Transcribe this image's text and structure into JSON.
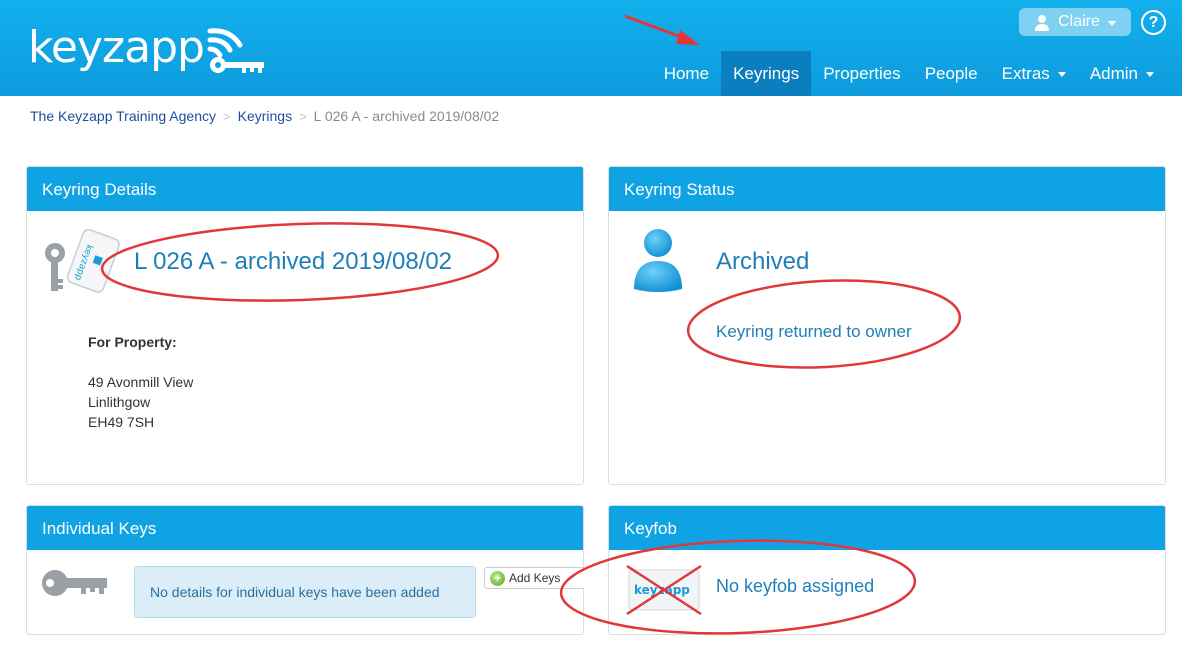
{
  "app": {
    "logo_text": "keyzapp",
    "brand_color": "#0fa3e4",
    "annotation_color": "#e0383a"
  },
  "header": {
    "user_label": "Claire",
    "help_label": "?",
    "nav": [
      {
        "label": "Home",
        "active": false
      },
      {
        "label": "Keyrings",
        "active": true
      },
      {
        "label": "Properties",
        "active": false
      },
      {
        "label": "People",
        "active": false
      },
      {
        "label": "Extras",
        "active": false,
        "dropdown": true
      },
      {
        "label": "Admin",
        "active": false,
        "dropdown": true
      }
    ]
  },
  "breadcrumb": {
    "agency": "The Keyzapp Training Agency",
    "keyrings": "Keyrings",
    "current": "L 026 A - archived 2019/08/02"
  },
  "details": {
    "heading": "Keyring Details",
    "keyring_name": "L 026 A - archived 2019/08/02",
    "property_label": "For Property:",
    "address_line1": "49 Avonmill View",
    "address_line2": "Linlithgow",
    "address_line3": "EH49 7SH",
    "icon": "keyring-fob-icon"
  },
  "status": {
    "heading": "Keyring Status",
    "state": "Archived",
    "reason": "Keyring returned to owner",
    "icon": "person-icon"
  },
  "keys": {
    "heading": "Individual Keys",
    "empty_message": "No details for individual keys have been added",
    "add_button": "Add Keys",
    "icon": "key-icon"
  },
  "keyfob": {
    "heading": "Keyfob",
    "message": "No keyfob assigned",
    "fob_text": "keyzapp",
    "icon": "keyfob-crossed-icon"
  }
}
